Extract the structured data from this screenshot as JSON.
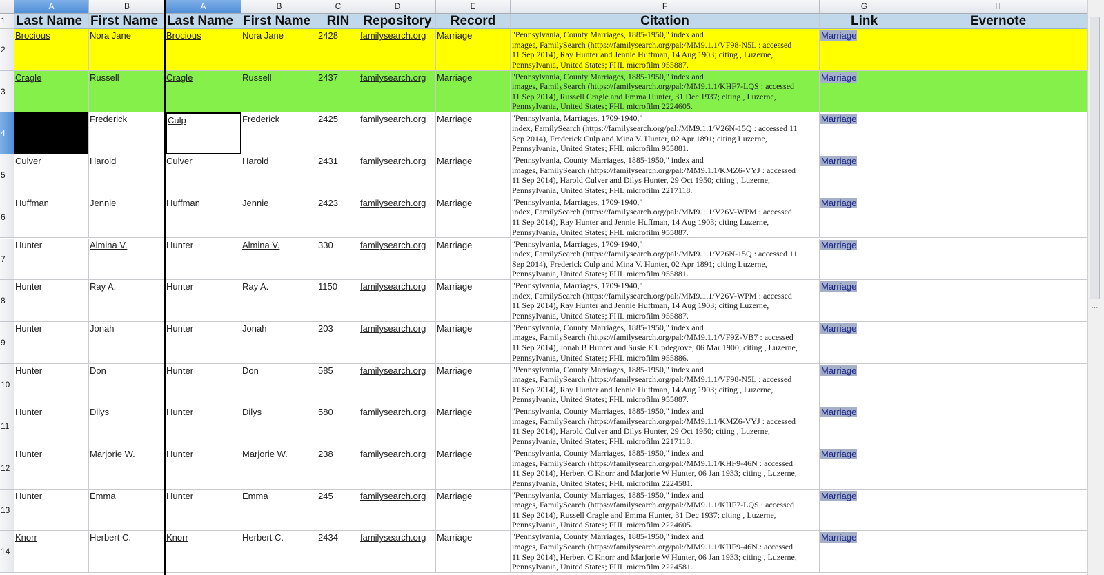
{
  "column_letters": [
    "A",
    "B",
    "A",
    "B",
    "C",
    "D",
    "E",
    "F",
    "G",
    "H"
  ],
  "headers": [
    "Last Name",
    "First Name",
    "Last Name",
    "First Name",
    "RIN",
    "Repository",
    "Record",
    "Citation",
    "Link",
    "Evernote"
  ],
  "row_numbers": [
    "1",
    "2",
    "3",
    "4",
    "5",
    "6",
    "7",
    "8",
    "9",
    "10",
    "11",
    "12",
    "13",
    "14"
  ],
  "selected_row": 4,
  "colors": {
    "header_fill": "#c1d7ea",
    "row_yellow": "#ffff00",
    "row_green": "#84f049",
    "black_cell": "#000000",
    "link_chip": "#a6b0c8"
  },
  "rows": [
    {
      "a": "Brocious",
      "b": "Nora Jane",
      "a2": "Brocious",
      "b2": "Nora Jane",
      "rin": "2428",
      "repo": "familysearch.org",
      "record": "Marriage",
      "citation": "\"Pennsylvania, County Marriages, 1885-1950,\" index and\nimages, FamilySearch (https://familysearch.org/pal:/MM9.1.1/VF98-N5L : accessed\n11 Sep 2014), Ray Hunter and Jennie Huffman, 14 Aug 1903; citing , Luzerne,\nPennsylvania, United States; FHL microfilm 955887.",
      "link": "Marriage",
      "evernote": "",
      "fill": "yellow"
    },
    {
      "a": "Cragle",
      "b": "Russell",
      "a2": "Cragle",
      "b2": "Russell",
      "rin": "2437",
      "repo": "familysearch.org",
      "record": "Marriage",
      "citation": "\"Pennsylvania, County Marriages, 1885-1950,\" index and\nimages, FamilySearch (https://familysearch.org/pal:/MM9.1.1/KHF7-LQS : accessed\n11 Sep 2014), Russell Cragle and Emma Hunter, 31 Dec 1937; citing , Luzerne,\nPennsylvania, United States; FHL microfilm 2224605.",
      "link": "Marriage",
      "evernote": "",
      "fill": "green"
    },
    {
      "a": "",
      "b": "Frederick",
      "a2": "Culp",
      "b2": "Frederick",
      "rin": "2425",
      "repo": "familysearch.org",
      "record": "Marriage",
      "citation": "\"Pennsylvania, Marriages, 1709-1940,\"\nindex, FamilySearch (https://familysearch.org/pal:/MM9.1.1/V26N-15Q : accessed 11\nSep 2014), Frederick Culp and Mina V. Hunter, 02 Apr 1891; citing Luzerne,\nPennsylvania, United States; FHL microfilm 955881.",
      "link": "Marriage",
      "evernote": "",
      "fill": ""
    },
    {
      "a": "Culver",
      "b": "Harold",
      "a2": "Culver",
      "b2": "Harold",
      "rin": "2431",
      "repo": "familysearch.org",
      "record": "Marriage",
      "citation": "\"Pennsylvania, County Marriages, 1885-1950,\" index and\nimages, FamilySearch (https://familysearch.org/pal:/MM9.1.1/KMZ6-VYJ : accessed\n11 Sep 2014), Harold Culver and Dilys Hunter, 29 Oct 1950; citing , Luzerne,\nPennsylvania, United States; FHL microfilm 2217118.",
      "link": "Marriage",
      "evernote": "",
      "fill": ""
    },
    {
      "a": "Huffman",
      "b": "Jennie",
      "a2": "Huffman",
      "b2": "Jennie",
      "rin": "2423",
      "repo": "familysearch.org",
      "record": "Marriage",
      "citation": "\"Pennsylvania, Marriages, 1709-1940,\"\nindex, FamilySearch (https://familysearch.org/pal:/MM9.1.1/V26V-WPM : accessed\n11 Sep 2014), Ray Hunter and Jennie Huffman, 14 Aug 1903; citing Luzerne,\nPennsylvania, United States; FHL microfilm 955887.",
      "link": "Marriage",
      "evernote": "",
      "fill": ""
    },
    {
      "a": "Hunter",
      "b": "Almina V.",
      "a2": "Hunter",
      "b2": "Almina V.",
      "rin": "330",
      "repo": "familysearch.org",
      "record": "Marriage",
      "citation": "\"Pennsylvania, Marriages, 1709-1940,\"\nindex, FamilySearch (https://familysearch.org/pal:/MM9.1.1/V26N-15Q : accessed 11\nSep 2014), Frederick Culp and Mina V. Hunter, 02 Apr 1891; citing Luzerne,\nPennsylvania, United States; FHL microfilm 955881.",
      "link": "Marriage",
      "evernote": "",
      "fill": ""
    },
    {
      "a": "Hunter",
      "b": "Ray A.",
      "a2": "Hunter",
      "b2": "Ray A.",
      "rin": "1150",
      "repo": "familysearch.org",
      "record": "Marriage",
      "citation": "\"Pennsylvania, Marriages, 1709-1940,\"\nindex, FamilySearch (https://familysearch.org/pal:/MM9.1.1/V26V-WPM : accessed\n11 Sep 2014), Ray Hunter and Jennie Huffman, 14 Aug 1903; citing Luzerne,\nPennsylvania, United States; FHL microfilm 955887.",
      "link": "Marriage",
      "evernote": "",
      "fill": ""
    },
    {
      "a": "Hunter",
      "b": "Jonah",
      "a2": "Hunter",
      "b2": "Jonah",
      "rin": "203",
      "repo": "familysearch.org",
      "record": "Marriage",
      "citation": "\"Pennsylvania, County Marriages, 1885-1950,\" index and\nimages, FamilySearch (https://familysearch.org/pal:/MM9.1.1/VF9Z-VB7 : accessed\n11 Sep 2014), Jonah B Hunter and Susie E Updegrove, 06 Mar 1900; citing , Luzerne,\nPennsylvania, United States; FHL microfilm 955886.",
      "link": "Marriage",
      "evernote": "",
      "fill": ""
    },
    {
      "a": "Hunter",
      "b": "Don",
      "a2": "Hunter",
      "b2": "Don",
      "rin": "585",
      "repo": "familysearch.org",
      "record": "Marriage",
      "citation": "\"Pennsylvania, County Marriages, 1885-1950,\" index and\nimages, FamilySearch (https://familysearch.org/pal:/MM9.1.1/VF98-N5L : accessed\n11 Sep 2014), Ray Hunter and Jennie Huffman, 14 Aug 1903; citing , Luzerne,\nPennsylvania, United States; FHL microfilm 955887.",
      "link": "Marriage",
      "evernote": "",
      "fill": ""
    },
    {
      "a": "Hunter",
      "b": "Dilys",
      "a2": "Hunter",
      "b2": "Dilys",
      "rin": "580",
      "repo": "familysearch.org",
      "record": "Marriage",
      "citation": "\"Pennsylvania, County Marriages, 1885-1950,\" index and\nimages, FamilySearch (https://familysearch.org/pal:/MM9.1.1/KMZ6-VYJ : accessed\n11 Sep 2014), Harold Culver and Dilys Hunter, 29 Oct 1950; citing , Luzerne,\nPennsylvania, United States; FHL microfilm 2217118.",
      "link": "Marriage",
      "evernote": "",
      "fill": ""
    },
    {
      "a": "Hunter",
      "b": "Marjorie W.",
      "a2": "Hunter",
      "b2": "Marjorie W.",
      "rin": "238",
      "repo": "familysearch.org",
      "record": "Marriage",
      "citation": "\"Pennsylvania, County Marriages, 1885-1950,\" index and\nimages, FamilySearch (https://familysearch.org/pal:/MM9.1.1/KHF9-46N : accessed\n11 Sep 2014), Herbert C Knorr and Marjorie W Hunter, 06 Jan 1933; citing , Luzerne,\nPennsylvania, United States; FHL microfilm 2224581.",
      "link": "Marriage",
      "evernote": "",
      "fill": ""
    },
    {
      "a": "Hunter",
      "b": "Emma",
      "a2": "Hunter",
      "b2": "Emma",
      "rin": "245",
      "repo": "familysearch.org",
      "record": "Marriage",
      "citation": "\"Pennsylvania, County Marriages, 1885-1950,\" index and\nimages, FamilySearch (https://familysearch.org/pal:/MM9.1.1/KHF7-LQS : accessed\n11 Sep 2014), Russell Cragle and Emma Hunter, 31 Dec 1937; citing , Luzerne,\nPennsylvania, United States; FHL microfilm 2224605.",
      "link": "Marriage",
      "evernote": "",
      "fill": ""
    },
    {
      "a": "Knorr",
      "b": "Herbert C.",
      "a2": "Knorr",
      "b2": "Herbert C.",
      "rin": "2434",
      "repo": "familysearch.org",
      "record": "Marriage",
      "citation": "\"Pennsylvania, County Marriages, 1885-1950,\" index and\nimages, FamilySearch (https://familysearch.org/pal:/MM9.1.1/KHF9-46N : accessed\n11 Sep 2014), Herbert C Knorr and Marjorie W Hunter, 06 Jan 1933; citing , Luzerne,\nPennsylvania, United States; FHL microfilm 2224581.",
      "link": "Marriage",
      "evernote": "",
      "fill": ""
    }
  ]
}
